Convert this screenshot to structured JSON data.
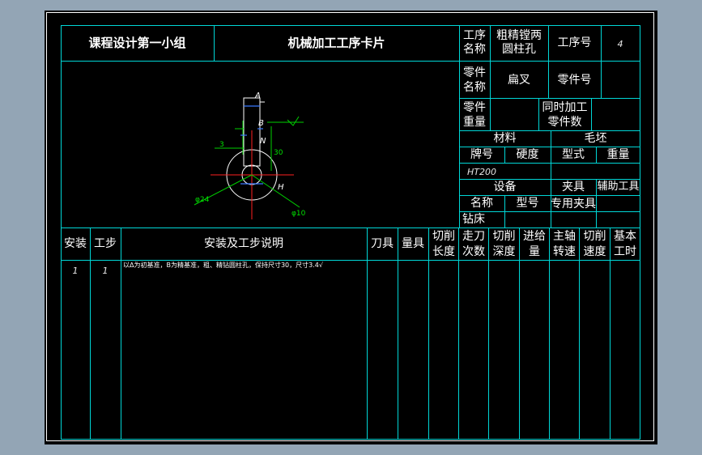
{
  "header": {
    "group_title": "课程设计第一小组",
    "card_title": "机械加工工序卡片",
    "process_name_label": "工序名称",
    "process_name_value": "粗精镗两圆柱孔",
    "process_no_label": "工序号",
    "process_no_value": "4",
    "part_name_label": "零件名称",
    "part_name_value": "扁叉",
    "part_no_label": "零件号",
    "part_weight_label": "零件重量",
    "simultaneous_label": "同时加工零件数"
  },
  "material": {
    "section_label": "材料",
    "grade_label": "牌号",
    "hardness_label": "硬度",
    "grade_value": "HT200"
  },
  "blank": {
    "section_label": "毛坯",
    "type_label": "型式",
    "weight_label": "重量"
  },
  "equipment": {
    "section_label": "设备",
    "name_label": "名称",
    "model_label": "型号",
    "name_value": "钻床"
  },
  "fixture": {
    "section_label": "夹具",
    "special_label": "专用夹具"
  },
  "aux_tool_label": "辅助工具",
  "drawing": {
    "dim_a": "A",
    "dim_b": "B",
    "dim_n": "N",
    "dim_3": "3",
    "dim_30": "30",
    "dim_24": "φ24",
    "dim_10": "φ10",
    "dim_h": "H"
  },
  "table": {
    "columns": [
      "安装",
      "工步",
      "安装及工步说明",
      "刀具",
      "量具",
      "切削长度",
      "走刀次数",
      "切削深度",
      "进给量",
      "主轴转速",
      "切削速度",
      "基本工时"
    ],
    "rows": [
      {
        "install": "1",
        "step": "1",
        "description": "以Δ为初基准，B为精基准，粗、精钻圆柱孔，保持尺寸30，尺寸3.4√"
      }
    ]
  }
}
